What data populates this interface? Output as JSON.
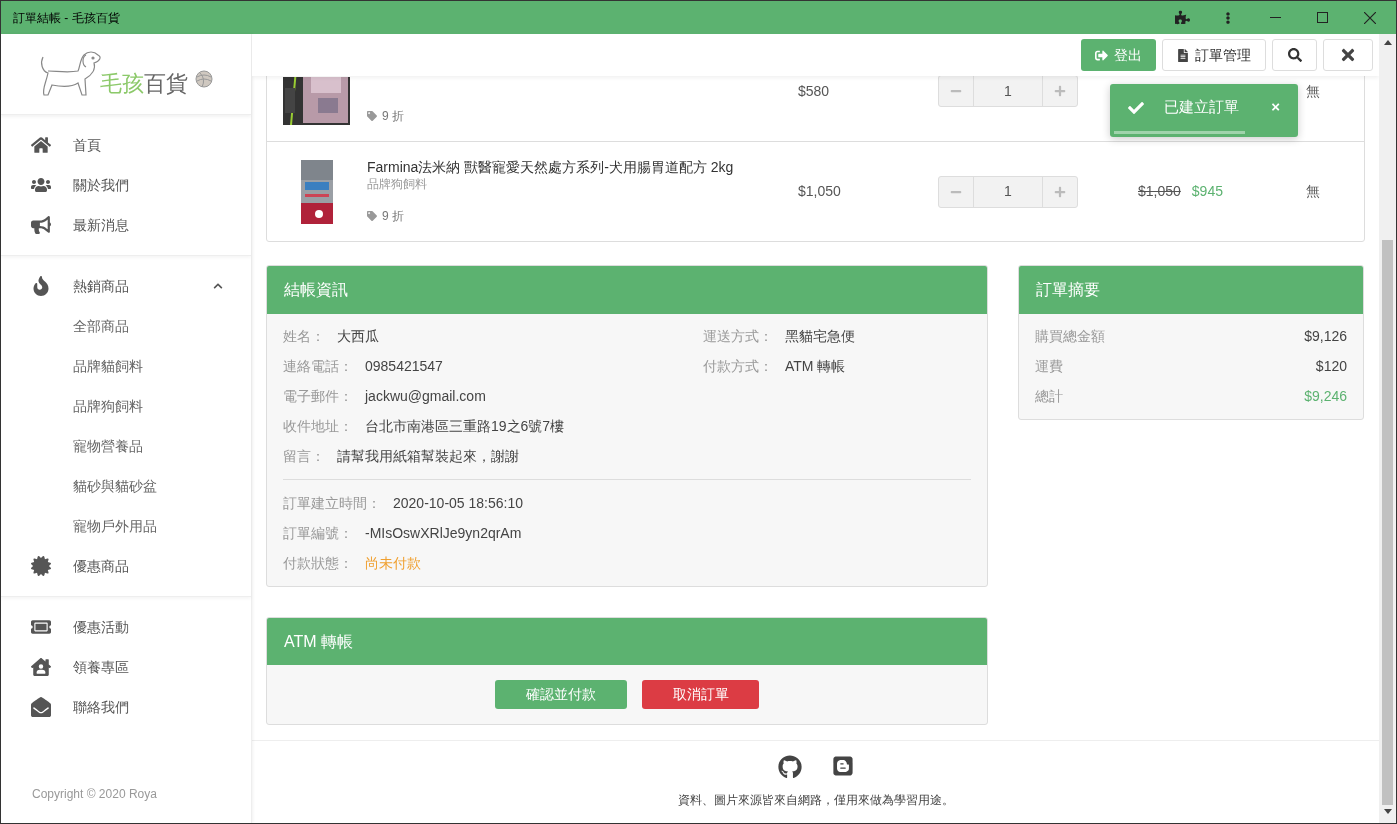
{
  "window": {
    "title": "訂單結帳 - 毛孩百貨"
  },
  "logo": {
    "part_1": "毛孩",
    "part_2": "百貨"
  },
  "sidebar": {
    "groups": [
      {
        "items": [
          {
            "label": "首頁"
          },
          {
            "label": "關於我們"
          },
          {
            "label": "最新消息"
          }
        ]
      },
      {
        "items": [
          {
            "label": "熱銷商品",
            "expanded": true,
            "children": [
              {
                "label": "全部商品"
              },
              {
                "label": "品牌貓飼料"
              },
              {
                "label": "品牌狗飼料"
              },
              {
                "label": "寵物營養品"
              },
              {
                "label": "貓砂與貓砂盆"
              },
              {
                "label": "寵物戶外用品"
              }
            ]
          },
          {
            "label": "優惠商品"
          }
        ]
      },
      {
        "items": [
          {
            "label": "優惠活動"
          },
          {
            "label": "領養專區"
          },
          {
            "label": "聯絡我們"
          }
        ]
      }
    ],
    "copyright": "Copyright © 2020 Roya"
  },
  "header": {
    "buttons": [
      {
        "kind": "primary",
        "label": "登出"
      },
      {
        "kind": "outline",
        "label": "訂單管理"
      },
      {
        "kind": "search"
      },
      {
        "kind": "close"
      }
    ]
  },
  "cart_rows": [
    {
      "discount": "9 折",
      "price": "$580",
      "quantity": "1",
      "note": "無"
    },
    {
      "title": "Farmina法米納 獸醫寵愛天然處方系列-犬用腸胃道配方 2kg",
      "category": "品牌狗飼料",
      "discount": "9 折",
      "price": "$1,050",
      "quantity": "1",
      "original_price": "$1,050",
      "sale_price": "$945",
      "note": "無"
    }
  ],
  "toast": {
    "message": "已建立訂單",
    "close": "×",
    "level": 0.73
  },
  "checkout": {
    "title": "結帳資訊",
    "left_fields": [
      {
        "label": "姓名：",
        "value": "大西瓜"
      },
      {
        "label": "連絡電話：",
        "value": "0985421547"
      },
      {
        "label": "電子郵件：",
        "value": "jackwu@gmail.com"
      },
      {
        "label": "收件地址：",
        "value": "台北市南港區三重路19之6號7樓"
      },
      {
        "label": "留言：",
        "value": "請幫我用紙箱幫裝起來，謝謝"
      }
    ],
    "right_fields": [
      {
        "label": "運送方式：",
        "value": "黑貓宅急便"
      },
      {
        "label": "付款方式：",
        "value": "ATM 轉帳"
      }
    ],
    "order_fields": [
      {
        "label": "訂單建立時間：",
        "value": "2020-10-05 18:56:10",
        "unpaid": false
      },
      {
        "label": "訂單編號：",
        "value": "-MIsOswXRlJe9yn2qrAm",
        "unpaid": false
      },
      {
        "label": "付款狀態：",
        "value": "尚未付款",
        "unpaid": true
      }
    ]
  },
  "summary": {
    "title": "訂單摘要",
    "rows": [
      {
        "label": "購買總金額",
        "value": "$9,126",
        "kind": "line"
      },
      {
        "label": "運費",
        "value": "$120",
        "kind": "line"
      },
      {
        "label": "總計",
        "value": "$9,246",
        "kind": "total"
      }
    ]
  },
  "atm": {
    "title": "ATM 轉帳",
    "buttons": [
      {
        "label": "確認並付款",
        "kind": "confirm"
      },
      {
        "label": "取消訂單",
        "kind": "cancel"
      }
    ]
  },
  "footer": {
    "text": "資料、圖片來源皆來自網路，僅用來做為學習用途。"
  }
}
